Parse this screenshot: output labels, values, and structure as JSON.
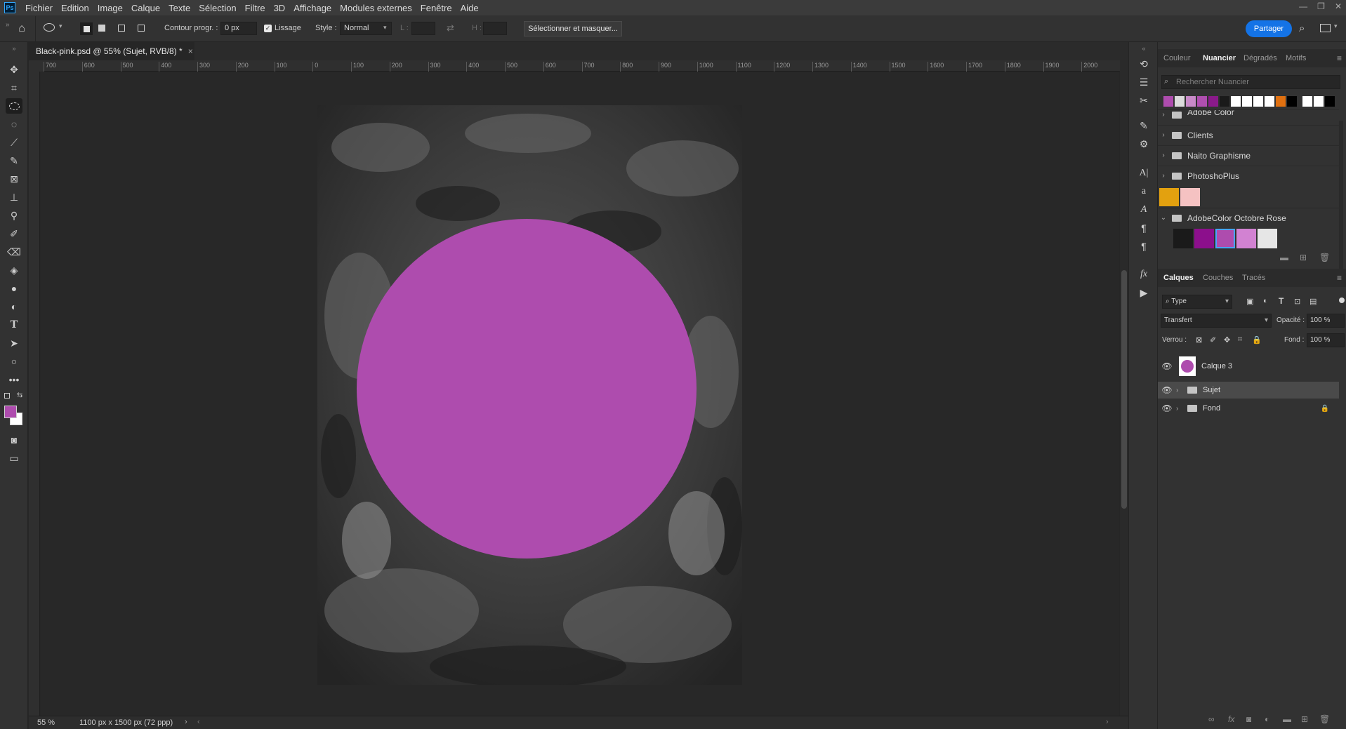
{
  "menu": {
    "logo": "Ps",
    "items": [
      "Fichier",
      "Edition",
      "Image",
      "Calque",
      "Texte",
      "Sélection",
      "Filtre",
      "3D",
      "Affichage",
      "Modules externes",
      "Fenêtre",
      "Aide"
    ],
    "window_controls": [
      "—",
      "❐",
      "✕"
    ]
  },
  "options": {
    "contour_label": "Contour progr. :",
    "contour_value": "0 px",
    "lissage_label": "Lissage",
    "style_label": "Style :",
    "style_value": "Normal",
    "width_label": "L :",
    "height_label": "H :",
    "select_mask_label": "Sélectionner et masquer...",
    "share_label": "Partager"
  },
  "document": {
    "tab_title": "Black-pink.psd @ 55% (Sujet, RVB/8) *",
    "close": "×"
  },
  "ruler": {
    "top_ticks": [
      "700",
      "600",
      "500",
      "400",
      "300",
      "200",
      "100",
      "0",
      "100",
      "200",
      "300",
      "400",
      "500",
      "600",
      "700",
      "800",
      "900",
      "1000",
      "1100",
      "1200",
      "1300",
      "1400",
      "1500",
      "1600",
      "1700",
      "1800",
      "1900",
      "2000"
    ]
  },
  "status": {
    "zoom": "55 %",
    "dimensions": "1100 px x 1500 px (72 ppp)"
  },
  "colors": {
    "foreground": "#ae4cae",
    "background": "#ffffff",
    "accent": "#1473e6",
    "circle": "#ae4cae"
  },
  "swatches_panel": {
    "tabs": [
      "Couleur",
      "Nuancier",
      "Dégradés",
      "Motifs"
    ],
    "active_tab": "Nuancier",
    "search_placeholder": "Rechercher Nuancier",
    "recent": [
      "#ae4cae",
      "#dcdcdc",
      "#c88ac8",
      "#b04fb0",
      "#8a1a8a",
      "#1a1a1a",
      "#ffffff",
      "#ffffff",
      "#ffffff",
      "#ffffff",
      "#e07010",
      "#000000",
      "#ffffff",
      "#ffffff",
      "#000000"
    ],
    "groups": [
      {
        "name": "Adobe Color",
        "expanded": false
      },
      {
        "name": "Clients",
        "expanded": false
      },
      {
        "name": "Naito Graphisme",
        "expanded": false
      },
      {
        "name": "PhotoshoPlus",
        "expanded": false
      }
    ],
    "loose_swatches": [
      "#e3a10f",
      "#f5c2c2"
    ],
    "open_group": {
      "name": "AdobeColor Octobre Rose",
      "swatches": [
        "#1a1a1a",
        "#8c0f8c",
        "#ae4cae",
        "#d282d2",
        "#e6e6e6"
      ]
    }
  },
  "layers_panel": {
    "tabs": [
      "Calques",
      "Couches",
      "Tracés"
    ],
    "active_tab": "Calques",
    "filter_label": "Type",
    "blend_mode": "Transfert",
    "opacity_label": "Opacité :",
    "opacity_value": "100 %",
    "lock_label": "Verrou :",
    "fill_label": "Fond :",
    "fill_value": "100 %",
    "layers": [
      {
        "name": "Calque 3",
        "type": "pixel",
        "selected": false
      },
      {
        "name": "Sujet",
        "type": "group",
        "selected": true
      },
      {
        "name": "Fond",
        "type": "group",
        "locked": true,
        "selected": false
      }
    ]
  }
}
